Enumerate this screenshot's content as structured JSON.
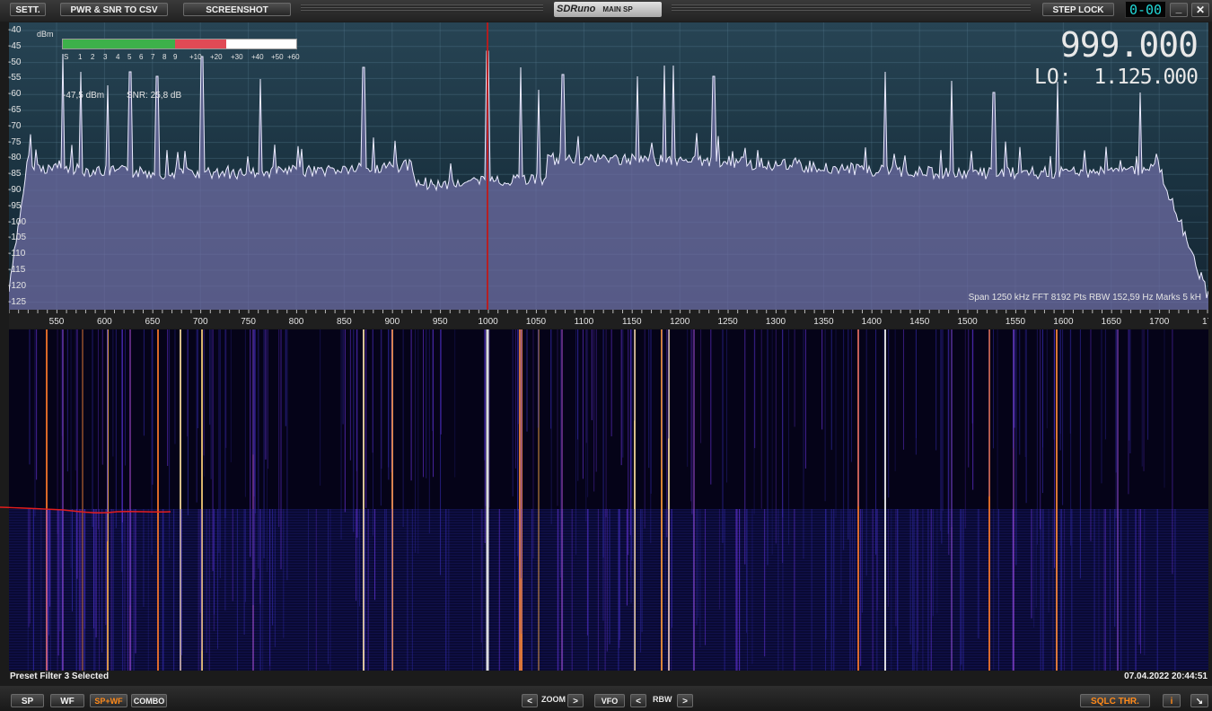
{
  "toolbar": {
    "settings": "SETT.",
    "export_csv": "PWR & SNR TO CSV",
    "screenshot": "SCREENSHOT",
    "logo_brand": "SDRuno",
    "window_name": "MAIN SP",
    "step_lock": "STEP LOCK",
    "step_display": "0-00",
    "minimize": "_",
    "close": "✕"
  },
  "spectrum": {
    "unit": "dBm",
    "ylabels": [
      "-40",
      "-45",
      "-50",
      "-55",
      "-60",
      "-65",
      "-70",
      "-75",
      "-80",
      "-85",
      "-90",
      "-95",
      "-100",
      "-105",
      "-110",
      "-115",
      "-120",
      "-125"
    ],
    "smeter_scale": [
      "S",
      "1",
      "2",
      "3",
      "4",
      "5",
      "6",
      "7",
      "8",
      "9",
      "+10",
      "+20",
      "+30",
      "+40",
      "+50",
      "+60"
    ],
    "smeter_level_fraction": 0.7,
    "signal": "-47,5 dBm",
    "snr": "SNR: 25,8 dB",
    "frequency": "999.000",
    "lo_label": "LO:",
    "lo_value": "1.125.000",
    "span_info": "Span 1250 kHz   FFT 8192 Pts   RBW 152,59 Hz   Marks 5 kH",
    "xlabels": [
      "550",
      "600",
      "650",
      "700",
      "750",
      "800",
      "850",
      "900",
      "950",
      "1000",
      "1050",
      "1100",
      "1150",
      "1200",
      "1250",
      "1300",
      "1350",
      "1400",
      "1450",
      "1500",
      "1550",
      "1600",
      "1650",
      "1700",
      "17"
    ]
  },
  "status": {
    "message": "Preset Filter 3 Selected",
    "datetime": "07.04.2022 20:44:51"
  },
  "bottom": {
    "sp": "SP",
    "wf": "WF",
    "spwf": "SP+WF",
    "combo": "COMBO",
    "zoom_prev": "<",
    "zoom": "ZOOM",
    "zoom_next": ">",
    "vfo": "VFO",
    "rbw_prev": "<",
    "rbw": "RBW",
    "rbw_next": ">",
    "sqlc": "SQLC THR.",
    "info": "i",
    "resize": "↘"
  },
  "colors": {
    "accent_orange": "#ff8a1a",
    "spectrum_trace": "#e8e8ff",
    "spectrum_fill": "#6a6aa0",
    "marker_line": "#c01818",
    "digits_cyan": "#22d8d8"
  }
}
